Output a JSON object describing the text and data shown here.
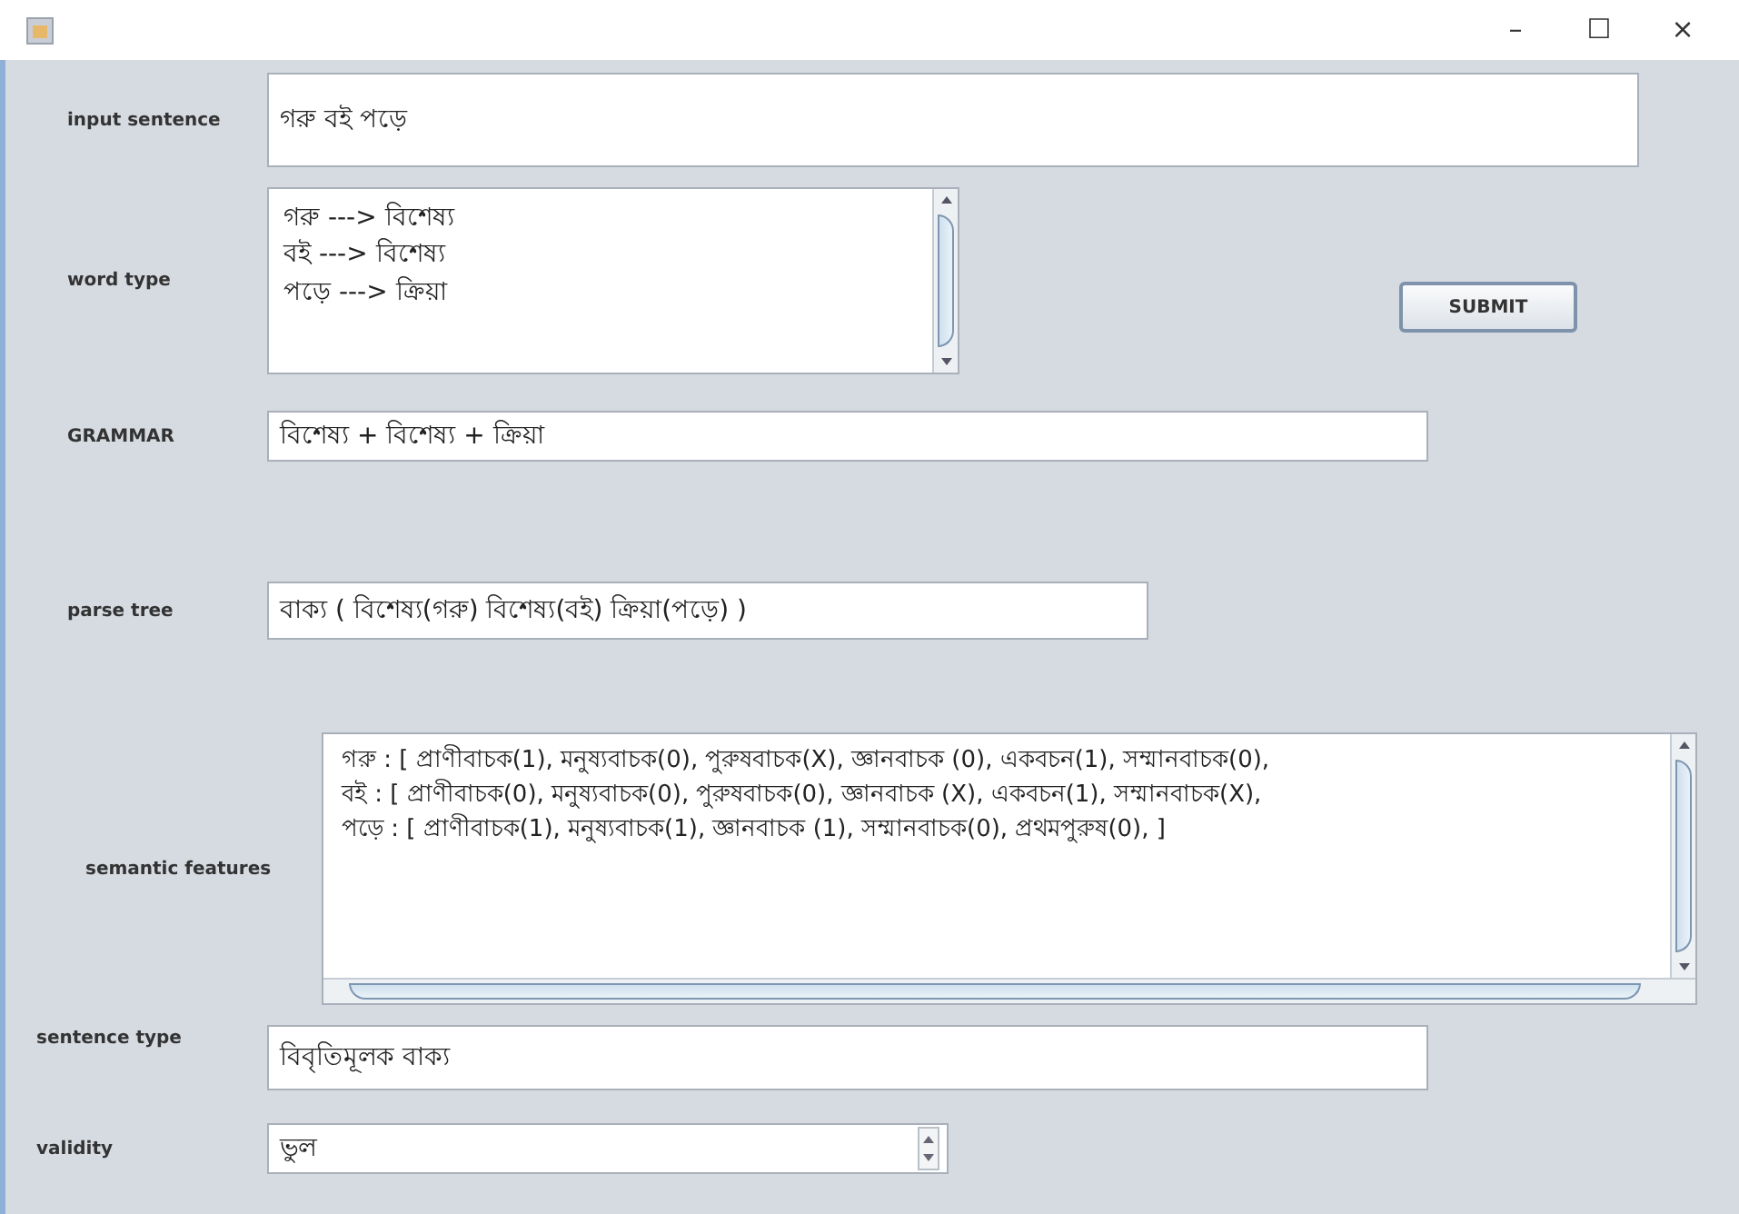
{
  "window": {
    "controls": [
      "–",
      "☐",
      "×"
    ]
  },
  "fields": [
    {
      "kind": "text",
      "label": "input sentence",
      "value": "গরু বই পড়ে"
    },
    {
      "kind": "textarea",
      "label": "word type",
      "lines": [
        "গরু ---> বিশেষ্য",
        "বই ---> বিশেষ্য",
        "পড়ে ---> ক্রিয়া"
      ]
    },
    {
      "kind": "text",
      "label": "GRAMMAR",
      "value": "বিশেষ্য + বিশেষ্য + ক্রিয়া"
    },
    {
      "kind": "text",
      "label": "parse tree",
      "value": "বাক্য ( বিশেষ্য(গরু) বিশেষ্য(বই) ক্রিয়া(পড়ে) )"
    },
    {
      "kind": "textarea2",
      "label": "semantic features",
      "lines": [
        "গরু : [ প্রাণীবাচক(1),  মনুষ্যবাচক(0),  পুরুষবাচক(X),  জ্ঞানবাচক (0), একবচন(1),  সম্মানবাচক(0),",
        "বই : [ প্রাণীবাচক(0),  মনুষ্যবাচক(0),  পুরুষবাচক(0),  জ্ঞানবাচক (X), একবচন(1), সম্মানবাচক(X),",
        "পড়ে : [ প্রাণীবাচক(1),  মনুষ্যবাচক(1),  জ্ঞানবাচক (1),  সম্মানবাচক(0), প্রথমপুরুষ(0),  ]"
      ]
    },
    {
      "kind": "text",
      "label": "sentence type",
      "value": "বিবৃতিমূলক  বাক্য"
    },
    {
      "kind": "spinner",
      "label": "validity",
      "value": "ভুল"
    }
  ],
  "submit": {
    "label": "SUBMIT"
  }
}
